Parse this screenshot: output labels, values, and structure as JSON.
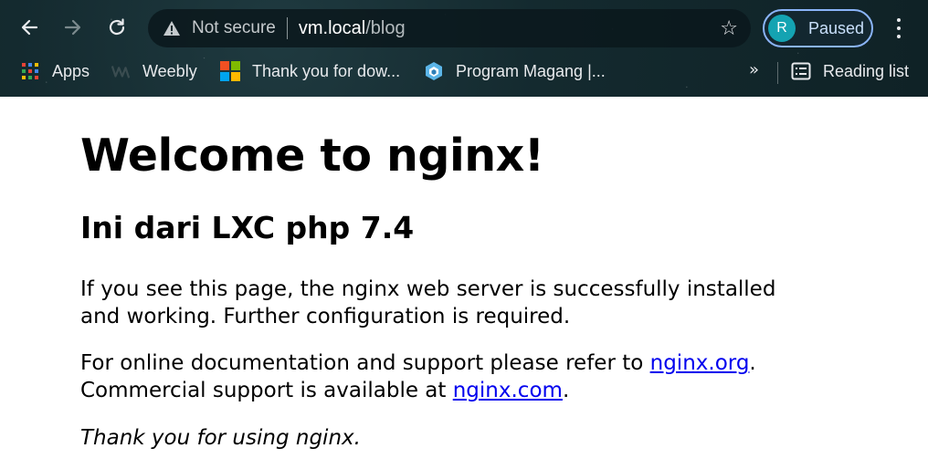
{
  "browser": {
    "omnibox": {
      "security_label": "Not secure",
      "host": "vm.local",
      "path": "/blog"
    },
    "profile": {
      "initial": "R",
      "status": "Paused",
      "avatar_color": "#14a3b2",
      "ring_color": "#8ab4f8"
    },
    "bookmarks": [
      {
        "label": "Apps",
        "icon": "apps-grid-icon"
      },
      {
        "label": "Weebly",
        "icon": "weebly-icon"
      },
      {
        "label": "Thank you for dow...",
        "icon": "microsoft-icon"
      },
      {
        "label": "Program Magang |...",
        "icon": "site-logo-icon"
      }
    ],
    "bookmarks_overflow": "»",
    "reading_list": "Reading list"
  },
  "page": {
    "title": "Welcome to nginx!",
    "subtitle": "Ini dari LXC php 7.4",
    "para1": "If you see this page, the nginx web server is successfully installed and working. Further configuration is required.",
    "para2_prefix": "For online documentation and support please refer to ",
    "link_org": "nginx.org",
    "para2_mid": ".",
    "para2_line2": "Commercial support is available at ",
    "link_com": "nginx.com",
    "para2_end": ".",
    "thanks": "Thank you for using nginx.",
    "link_color": "#0000ee"
  }
}
